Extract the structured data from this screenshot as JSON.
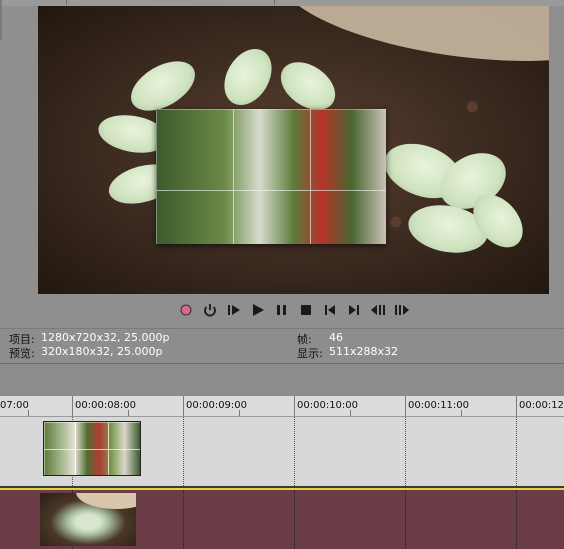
{
  "transport": {
    "buttons": [
      {
        "name": "record-icon"
      },
      {
        "name": "loop-icon"
      },
      {
        "name": "play-from-start-icon"
      },
      {
        "name": "play-icon"
      },
      {
        "name": "pause-icon"
      },
      {
        "name": "stop-icon"
      },
      {
        "name": "previous-frame-icon"
      },
      {
        "name": "next-frame-icon"
      },
      {
        "name": "step-back-icon"
      },
      {
        "name": "step-forward-icon"
      }
    ]
  },
  "info": {
    "project_label": "项目:",
    "project_value": "1280x720x32, 25.000p",
    "preview_label": "预览:",
    "preview_value": "320x180x32, 25.000p",
    "frame_label": "帧:",
    "frame_value": "46",
    "display_label": "显示:",
    "display_value": "511x288x32"
  },
  "ruler": {
    "labels": [
      "07:00",
      "00:00:08:00",
      "00:00:09:00",
      "00:00:10:00",
      "00:00:11:00",
      "00:00:12"
    ]
  },
  "colors": {
    "record_accent": "#d96a8a",
    "lower_track": "#6b3b47",
    "playline": "#e1d33a"
  }
}
